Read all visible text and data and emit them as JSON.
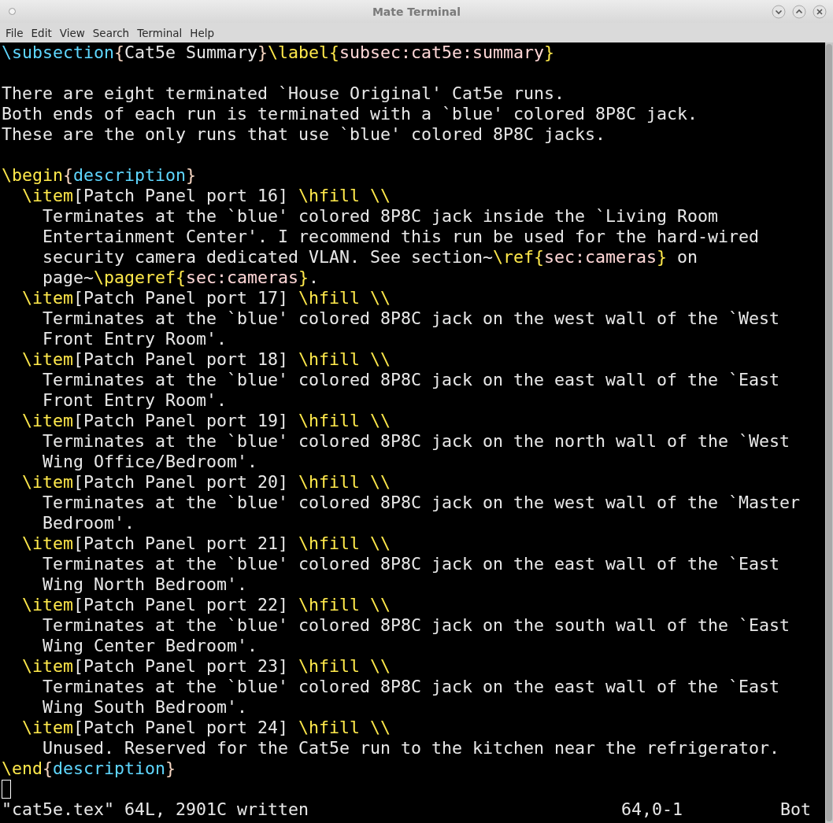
{
  "window": {
    "title": "Mate Terminal"
  },
  "menu": [
    "File",
    "Edit",
    "View",
    "Search",
    "Terminal",
    "Help"
  ],
  "lines": [
    {
      "kind": "code",
      "segments": [
        {
          "kind": "sec",
          "text": "\\subsection"
        },
        {
          "kind": "brace",
          "text": "{"
        },
        {
          "kind": "text",
          "text": "Cat5e Summary"
        },
        {
          "kind": "brace",
          "text": "}"
        },
        {
          "kind": "cmd",
          "text": "\\label{"
        },
        {
          "kind": "arg",
          "text": "subsec:cat5e:summary"
        },
        {
          "kind": "cmd",
          "text": "}"
        }
      ]
    },
    {
      "kind": "blank"
    },
    {
      "kind": "code",
      "segments": [
        {
          "kind": "text",
          "text": "There are eight terminated `House Original' Cat5e runs."
        }
      ]
    },
    {
      "kind": "code",
      "segments": [
        {
          "kind": "text",
          "text": "Both ends of each run is terminated with a `blue' colored 8P8C jack."
        }
      ]
    },
    {
      "kind": "code",
      "segments": [
        {
          "kind": "text",
          "text": "These are the only runs that use `blue' colored 8P8C jacks."
        }
      ]
    },
    {
      "kind": "blank"
    },
    {
      "kind": "code",
      "segments": [
        {
          "kind": "cmd",
          "text": "\\begin"
        },
        {
          "kind": "brace",
          "text": "{"
        },
        {
          "kind": "env",
          "text": "description"
        },
        {
          "kind": "brace",
          "text": "}"
        }
      ]
    },
    {
      "kind": "code",
      "segments": [
        {
          "kind": "cmd",
          "text": "  \\item"
        },
        {
          "kind": "text",
          "text": "[Patch Panel port 16] "
        },
        {
          "kind": "cmd",
          "text": "\\hfill \\\\"
        }
      ]
    },
    {
      "kind": "code",
      "segments": [
        {
          "kind": "text",
          "text": "    Terminates at the `blue' colored 8P8C jack inside the `Living Room"
        }
      ]
    },
    {
      "kind": "code",
      "segments": [
        {
          "kind": "text",
          "text": "    Entertainment Center'. I recommend this run be used for the hard-wired"
        }
      ]
    },
    {
      "kind": "code",
      "segments": [
        {
          "kind": "text",
          "text": "    security camera dedicated VLAN. See section~"
        },
        {
          "kind": "cmd",
          "text": "\\ref{"
        },
        {
          "kind": "arg",
          "text": "sec:cameras"
        },
        {
          "kind": "cmd",
          "text": "}"
        },
        {
          "kind": "text",
          "text": " on"
        }
      ]
    },
    {
      "kind": "code",
      "segments": [
        {
          "kind": "text",
          "text": "    page~"
        },
        {
          "kind": "cmd",
          "text": "\\pageref{"
        },
        {
          "kind": "arg",
          "text": "sec:cameras"
        },
        {
          "kind": "cmd",
          "text": "}"
        },
        {
          "kind": "text",
          "text": "."
        }
      ]
    },
    {
      "kind": "code",
      "segments": [
        {
          "kind": "cmd",
          "text": "  \\item"
        },
        {
          "kind": "text",
          "text": "[Patch Panel port 17] "
        },
        {
          "kind": "cmd",
          "text": "\\hfill \\\\"
        }
      ]
    },
    {
      "kind": "code",
      "segments": [
        {
          "kind": "text",
          "text": "    Terminates at the `blue' colored 8P8C jack on the west wall of the `West"
        }
      ]
    },
    {
      "kind": "code",
      "segments": [
        {
          "kind": "text",
          "text": "    Front Entry Room'."
        }
      ]
    },
    {
      "kind": "code",
      "segments": [
        {
          "kind": "cmd",
          "text": "  \\item"
        },
        {
          "kind": "text",
          "text": "[Patch Panel port 18] "
        },
        {
          "kind": "cmd",
          "text": "\\hfill \\\\"
        }
      ]
    },
    {
      "kind": "code",
      "segments": [
        {
          "kind": "text",
          "text": "    Terminates at the `blue' colored 8P8C jack on the east wall of the `East"
        }
      ]
    },
    {
      "kind": "code",
      "segments": [
        {
          "kind": "text",
          "text": "    Front Entry Room'."
        }
      ]
    },
    {
      "kind": "code",
      "segments": [
        {
          "kind": "cmd",
          "text": "  \\item"
        },
        {
          "kind": "text",
          "text": "[Patch Panel port 19] "
        },
        {
          "kind": "cmd",
          "text": "\\hfill \\\\"
        }
      ]
    },
    {
      "kind": "code",
      "segments": [
        {
          "kind": "text",
          "text": "    Terminates at the `blue' colored 8P8C jack on the north wall of the `West"
        }
      ]
    },
    {
      "kind": "code",
      "segments": [
        {
          "kind": "text",
          "text": "    Wing Office/Bedroom'."
        }
      ]
    },
    {
      "kind": "code",
      "segments": [
        {
          "kind": "cmd",
          "text": "  \\item"
        },
        {
          "kind": "text",
          "text": "[Patch Panel port 20] "
        },
        {
          "kind": "cmd",
          "text": "\\hfill \\\\"
        }
      ]
    },
    {
      "kind": "code",
      "segments": [
        {
          "kind": "text",
          "text": "    Terminates at the `blue' colored 8P8C jack on the west wall of the `Master"
        }
      ]
    },
    {
      "kind": "code",
      "segments": [
        {
          "kind": "text",
          "text": "    Bedroom'."
        }
      ]
    },
    {
      "kind": "code",
      "segments": [
        {
          "kind": "cmd",
          "text": "  \\item"
        },
        {
          "kind": "text",
          "text": "[Patch Panel port 21] "
        },
        {
          "kind": "cmd",
          "text": "\\hfill \\\\"
        }
      ]
    },
    {
      "kind": "code",
      "segments": [
        {
          "kind": "text",
          "text": "    Terminates at the `blue' colored 8P8C jack on the east wall of the `East"
        }
      ]
    },
    {
      "kind": "code",
      "segments": [
        {
          "kind": "text",
          "text": "    Wing North Bedroom'."
        }
      ]
    },
    {
      "kind": "code",
      "segments": [
        {
          "kind": "cmd",
          "text": "  \\item"
        },
        {
          "kind": "text",
          "text": "[Patch Panel port 22] "
        },
        {
          "kind": "cmd",
          "text": "\\hfill \\\\"
        }
      ]
    },
    {
      "kind": "code",
      "segments": [
        {
          "kind": "text",
          "text": "    Terminates at the `blue' colored 8P8C jack on the south wall of the `East"
        }
      ]
    },
    {
      "kind": "code",
      "segments": [
        {
          "kind": "text",
          "text": "    Wing Center Bedroom'."
        }
      ]
    },
    {
      "kind": "code",
      "segments": [
        {
          "kind": "cmd",
          "text": "  \\item"
        },
        {
          "kind": "text",
          "text": "[Patch Panel port 23] "
        },
        {
          "kind": "cmd",
          "text": "\\hfill \\\\"
        }
      ]
    },
    {
      "kind": "code",
      "segments": [
        {
          "kind": "text",
          "text": "    Terminates at the `blue' colored 8P8C jack on the east wall of the `East"
        }
      ]
    },
    {
      "kind": "code",
      "segments": [
        {
          "kind": "text",
          "text": "    Wing South Bedroom'."
        }
      ]
    },
    {
      "kind": "code",
      "segments": [
        {
          "kind": "cmd",
          "text": "  \\item"
        },
        {
          "kind": "text",
          "text": "[Patch Panel port 24] "
        },
        {
          "kind": "cmd",
          "text": "\\hfill \\\\"
        }
      ]
    },
    {
      "kind": "code",
      "segments": [
        {
          "kind": "text",
          "text": "    Unused. Reserved for the Cat5e run to the kitchen near the refrigerator."
        }
      ]
    },
    {
      "kind": "code",
      "segments": [
        {
          "kind": "cmd",
          "text": "\\end"
        },
        {
          "kind": "brace",
          "text": "{"
        },
        {
          "kind": "env",
          "text": "description"
        },
        {
          "kind": "brace",
          "text": "}"
        }
      ]
    },
    {
      "kind": "cursor"
    }
  ],
  "status_line": {
    "message": "\"cat5e.tex\" 64L, 2901C written",
    "position": "64,0-1",
    "scroll": "Bot"
  }
}
